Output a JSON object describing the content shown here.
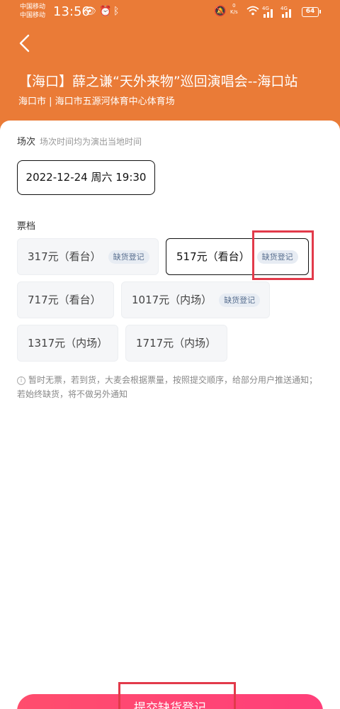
{
  "status_bar": {
    "carrier_1": "中国移动",
    "carrier_2": "中国移动",
    "time": "13:56",
    "net_speed": "0",
    "net_unit": "K/s",
    "network_1": "4G",
    "network_2": "4G",
    "battery": "64"
  },
  "header": {
    "title": "【海口】薛之谦“天外来物”巡回演唱会--海口站",
    "venue": "海口市 | 海口市五源河体育中心体育场"
  },
  "session": {
    "label": "场次",
    "hint": "场次时间均为演出当地时间",
    "selected": "2022-12-24 周六 19:30"
  },
  "tickets": {
    "label": "票档",
    "items": [
      {
        "price": "317元（看台）",
        "badge": "缺货登记"
      },
      {
        "price": "517元（看台）",
        "badge": "缺货登记",
        "selected": true
      },
      {
        "price": "717元（看台）",
        "badge": ""
      },
      {
        "price": "1017元（内场）",
        "badge": "缺货登记"
      },
      {
        "price": "1317元（内场）",
        "badge": ""
      },
      {
        "price": "1717元（内场）",
        "badge": ""
      }
    ]
  },
  "notice": "暂时无票，若到货，大麦会根据票量，按照提交顺序，给部分用户推送通知；若始终缺货，将不做另外通知",
  "submit_button": "提交缺货登记",
  "colors": {
    "header_bg": "#ea7b37",
    "button": "#ff4d6d",
    "highlight": "#e23a4a"
  }
}
